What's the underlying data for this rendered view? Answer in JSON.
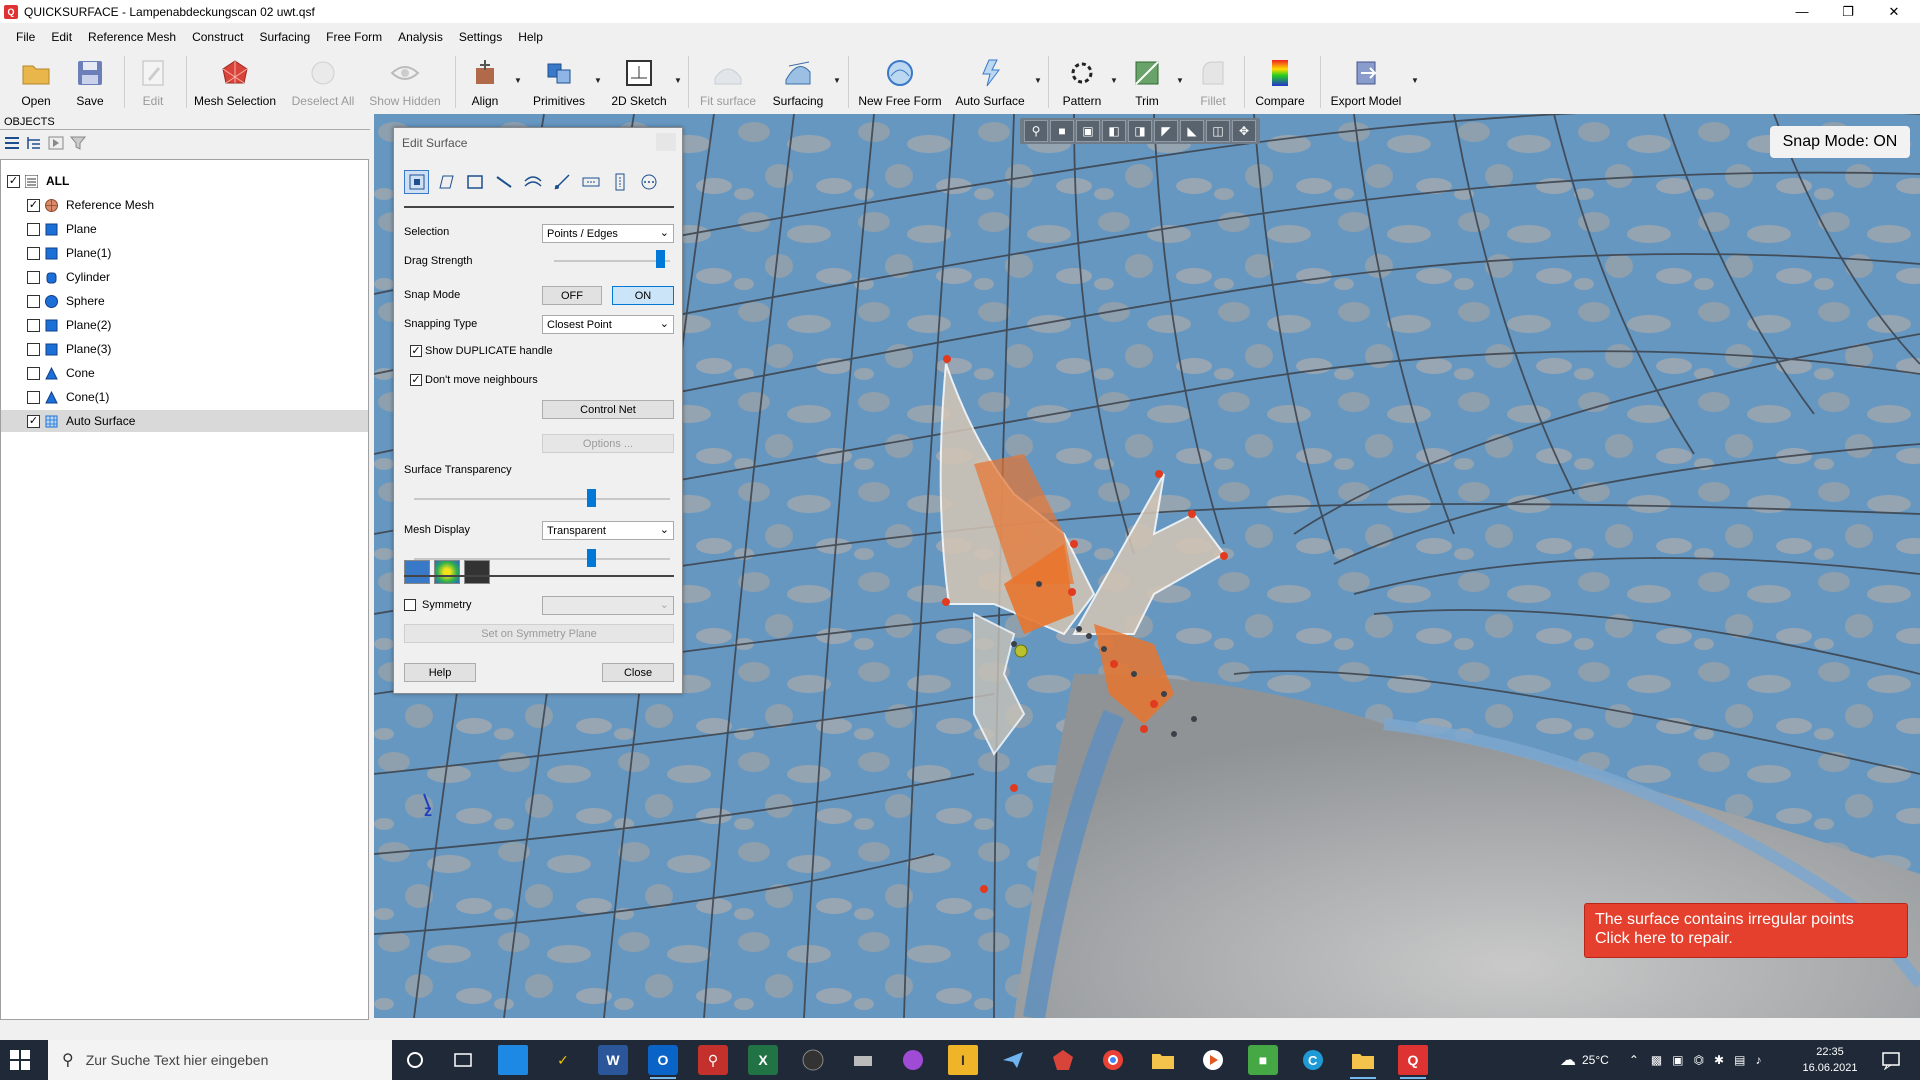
{
  "window": {
    "title": "QUICKSURFACE - Lampenabdeckungscan 02 uwt.qsf",
    "app_icon": "Q",
    "controls": [
      "minimize-icon",
      "restore-icon",
      "close-icon"
    ]
  },
  "menu": [
    "File",
    "Edit",
    "Reference Mesh",
    "Construct",
    "Surfacing",
    "Free Form",
    "Analysis",
    "Settings",
    "Help"
  ],
  "toolbar": {
    "open": "Open",
    "save": "Save",
    "edit": "Edit",
    "mesh_selection": "Mesh Selection",
    "deselect_all": "Deselect All",
    "show_hidden": "Show Hidden",
    "align": "Align",
    "primitives": "Primitives",
    "sketch_2d": "2D Sketch",
    "fit_surface": "Fit surface",
    "surfacing": "Surfacing",
    "new_free_form": "New Free Form",
    "auto_surface": "Auto Surface",
    "pattern": "Pattern",
    "trim": "Trim",
    "fillet": "Fillet",
    "compare": "Compare",
    "export_model": "Export Model"
  },
  "objects": {
    "header": "OBJECTS",
    "root": "ALL",
    "items": [
      {
        "label": "Reference Mesh",
        "checked": true,
        "icon": "mesh-icon"
      },
      {
        "label": "Plane",
        "checked": false,
        "icon": "plane-icon"
      },
      {
        "label": "Plane(1)",
        "checked": false,
        "icon": "plane-icon"
      },
      {
        "label": "Cylinder",
        "checked": false,
        "icon": "cylinder-icon"
      },
      {
        "label": "Sphere",
        "checked": false,
        "icon": "sphere-icon"
      },
      {
        "label": "Plane(2)",
        "checked": false,
        "icon": "plane-icon"
      },
      {
        "label": "Plane(3)",
        "checked": false,
        "icon": "plane-icon"
      },
      {
        "label": "Cone",
        "checked": false,
        "icon": "cone-icon"
      },
      {
        "label": "Cone(1)",
        "checked": false,
        "icon": "cone-icon"
      },
      {
        "label": "Auto Surface",
        "checked": true,
        "icon": "surface-icon",
        "selected": true
      }
    ]
  },
  "dialog": {
    "title": "Edit Surface",
    "selection_label": "Selection",
    "selection_value": "Points / Edges",
    "drag_strength_label": "Drag Strength",
    "drag_strength_level": 0.95,
    "snap_mode_label": "Snap Mode",
    "snap_off": "OFF",
    "snap_on": "ON",
    "snapping_type_label": "Snapping Type",
    "snapping_type_value": "Closest Point",
    "show_duplicate_label": "Show DUPLICATE handle",
    "dont_move_label": "Don't move neighbours",
    "control_net": "Control Net",
    "options": "Options ...",
    "surface_transparency_label": "Surface Transparency",
    "surface_transparency_level": 0.7,
    "mesh_display_label": "Mesh Display",
    "mesh_display_value": "Transparent",
    "mesh_display_level": 0.7,
    "symmetry_label": "Symmetry",
    "set_symmetry": "Set on Symmetry Plane",
    "help": "Help",
    "close": "Close"
  },
  "viewport": {
    "snap_mode_badge": "Snap Mode: ON",
    "repair_line1": "The surface contains irregular points",
    "repair_line2": "Click here to repair.",
    "axis_label": "z",
    "colors": {
      "mesh_blue": "#6a9ac4",
      "surface_gray": "#a9b0b4",
      "highlight": "#e8742e",
      "control_point": "#e23a1e"
    }
  },
  "taskbar": {
    "search_placeholder": "Zur Suche Text hier eingeben",
    "temperature": "25°C",
    "time": "22:35",
    "date": "16.06.2021"
  }
}
